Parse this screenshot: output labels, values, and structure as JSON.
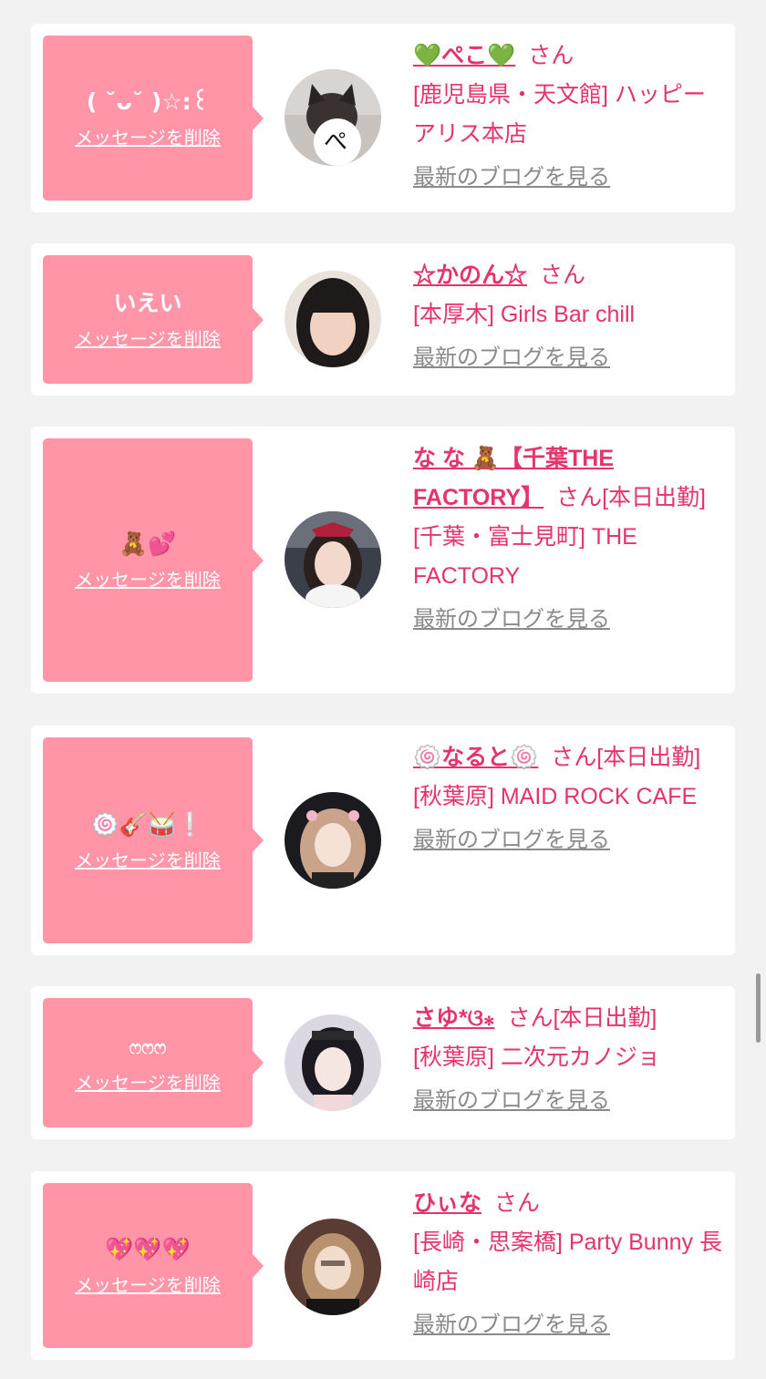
{
  "delete_label": "メッセージを削除",
  "blog_label": "最新のブログを見る",
  "cards": [
    {
      "message": "( ˘ᴗ˘ )☆:꒰",
      "name": "💚ぺこ💚",
      "suffix": "さん",
      "extra": "",
      "shop": "[鹿児島県・天文館] ハッピーアリス本店"
    },
    {
      "message": "いえい",
      "name": "☆かのん☆",
      "suffix": "さん",
      "extra": "",
      "shop": "[本厚木] Girls Bar chill"
    },
    {
      "message": "🧸💕",
      "name": "な な 🧸【千葉THE FACTORY】",
      "suffix": "さん",
      "extra": "[本日出勤]",
      "shop": "[千葉・富士見町] THE FACTORY"
    },
    {
      "message": "🍥🎸🥁❕",
      "name": "🍥なると🍥",
      "suffix": "さん",
      "extra": "[本日出勤]",
      "shop": "[秋葉原] MAID ROCK CAFE"
    },
    {
      "message": "ෆෆෆ",
      "name": "さゆ*ଓ⁎",
      "suffix": "さん",
      "extra": "[本日出勤]",
      "shop": "[秋葉原] 二次元カノジョ"
    },
    {
      "message": "💖💖💖",
      "name": "ひぃな",
      "suffix": "さん",
      "extra": "",
      "shop": "[長崎・思案橋] Party Bunny 長崎店"
    }
  ]
}
